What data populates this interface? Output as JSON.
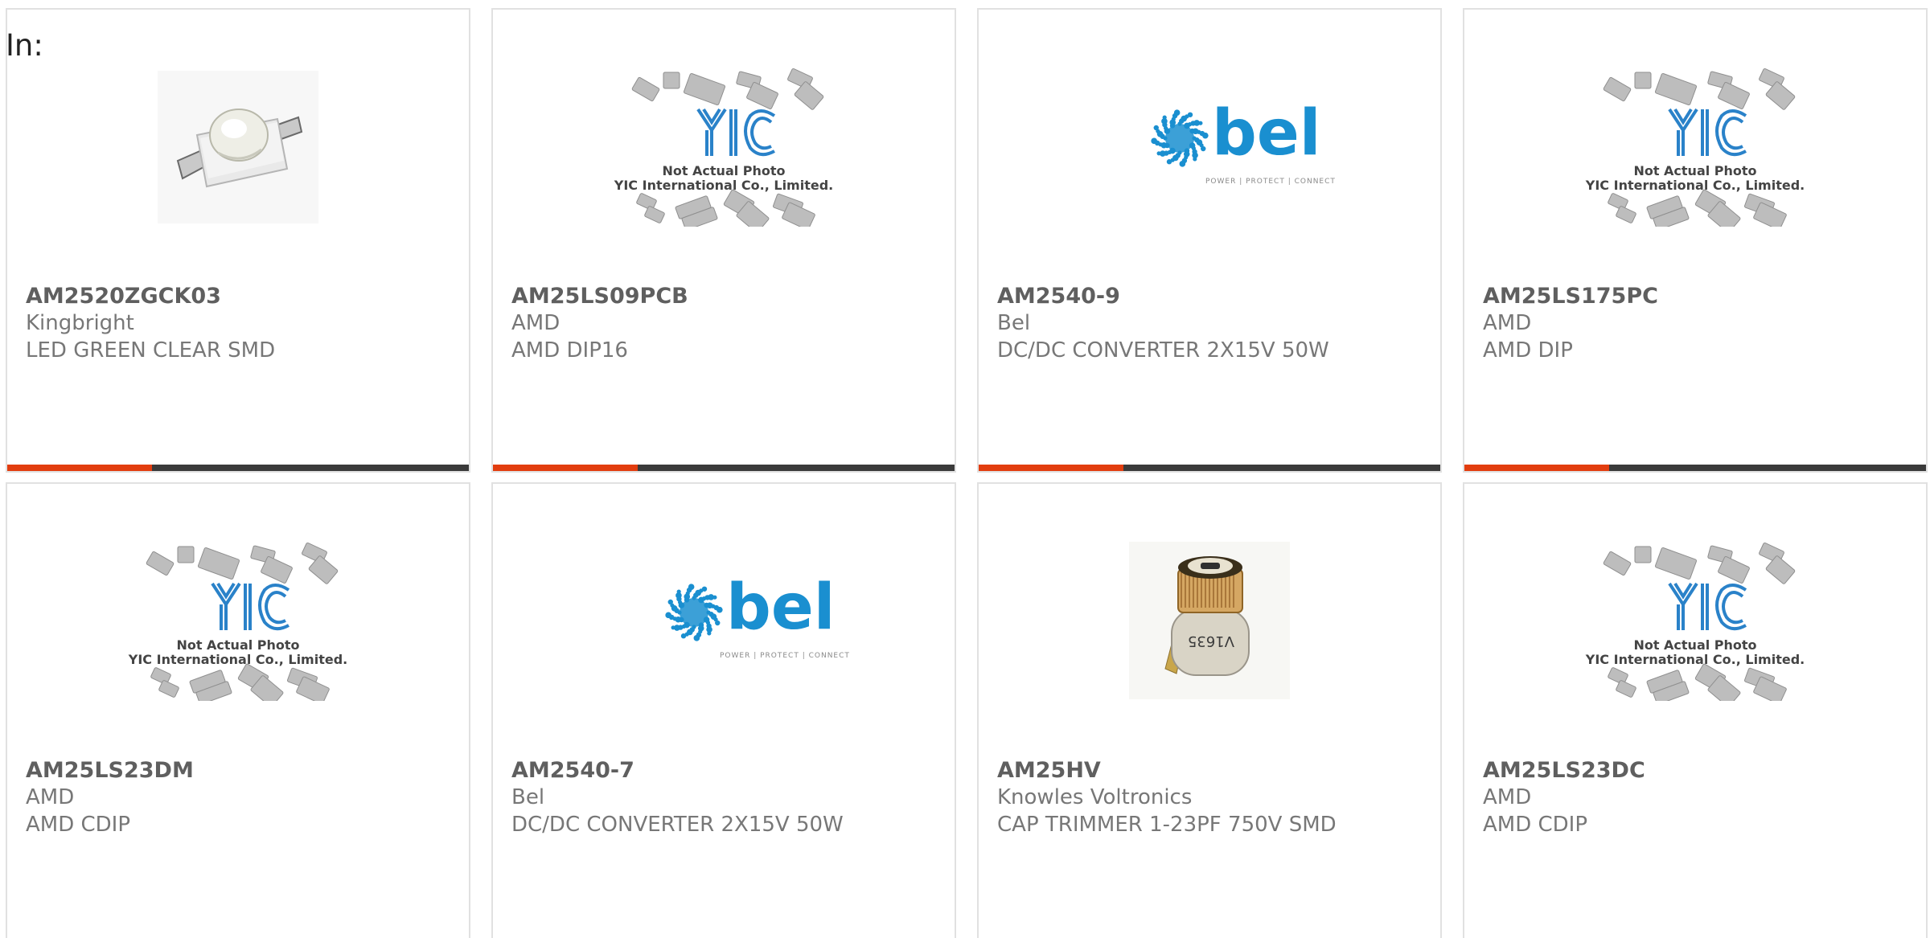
{
  "header": {
    "filter_label": "In:"
  },
  "colors": {
    "bar_accent": "#e23d0f",
    "bar_dark": "#3a3a3a",
    "bel_blue": "#1a8fd0",
    "yic_blue": "#2a82c9"
  },
  "placeholder": {
    "line1": "Not Actual Photo",
    "line2": "YIC International Co., Limited."
  },
  "bel_logo": {
    "name": "bel",
    "tagline": "POWER | PROTECT | CONNECT"
  },
  "products": [
    {
      "part": "AM2520ZGCK03",
      "maker": "Kingbright",
      "desc": "LED GREEN CLEAR SMD",
      "image": "led-photo-icon"
    },
    {
      "part": "AM25LS09PCB",
      "maker": "AMD",
      "desc": "AMD DIP16",
      "image": "yic-placeholder-icon"
    },
    {
      "part": "AM2540-9",
      "maker": "Bel",
      "desc": "DC/DC CONVERTER 2X15V 50W",
      "image": "bel-logo-icon"
    },
    {
      "part": "AM25LS175PC",
      "maker": "AMD",
      "desc": "AMD DIP",
      "image": "yic-placeholder-icon"
    },
    {
      "part": "AM25LS23DM",
      "maker": "AMD",
      "desc": "AMD CDIP",
      "image": "yic-placeholder-icon"
    },
    {
      "part": "AM2540-7",
      "maker": "Bel",
      "desc": "DC/DC CONVERTER 2X15V 50W",
      "image": "bel-logo-icon"
    },
    {
      "part": "AM25HV",
      "maker": "Knowles Voltronics",
      "desc": "CAP TRIMMER 1-23PF 750V SMD",
      "image": "trimmer-cap-photo-icon"
    },
    {
      "part": "AM25LS23DC",
      "maker": "AMD",
      "desc": "AMD CDIP",
      "image": "yic-placeholder-icon"
    }
  ]
}
